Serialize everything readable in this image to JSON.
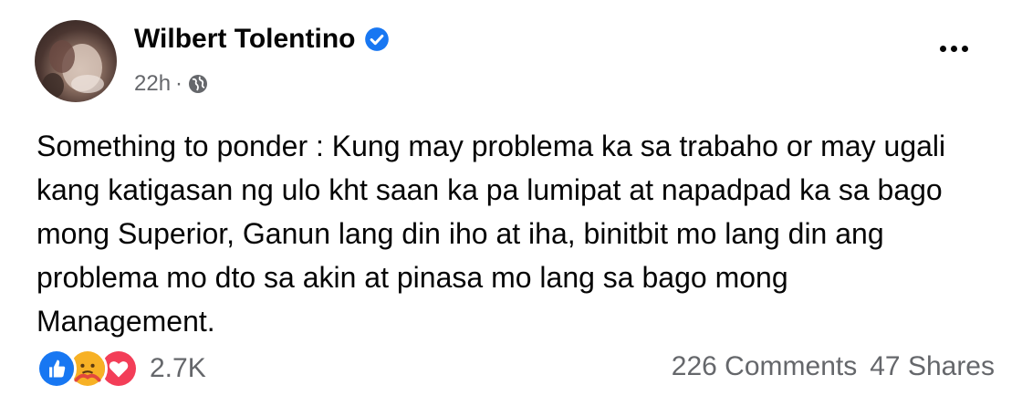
{
  "post": {
    "author": "Wilbert Tolentino",
    "time": "22h",
    "separator": "·",
    "text_lines": [
      "Something to ponder : Kung may problema ka sa trabaho or may ugali",
      "kang katigasan ng ulo kht saan ka pa lumipat at napadpad ka sa bago",
      "mong Superior, Ganun lang din iho at iha, binitbit mo lang din ang",
      "problema mo dto sa akin at pinasa mo lang sa bago mong",
      "Management."
    ],
    "reactions": {
      "icons": [
        "like-icon",
        "care-icon",
        "love-icon"
      ],
      "count": "2.7K"
    },
    "comments": "226 Comments",
    "shares": "47 Shares"
  },
  "colors": {
    "secondary_text": "#65676b",
    "like_blue": "#1877f2",
    "love_red": "#f33e58",
    "care_yellow": "#f7b125"
  }
}
